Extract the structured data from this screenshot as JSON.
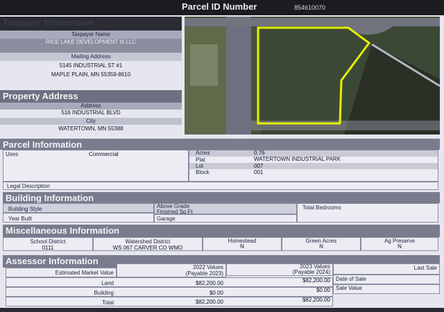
{
  "header": {
    "parcel_id_label": "Parcel ID Number",
    "parcel_id": "854610070"
  },
  "taxpayer": {
    "section_title": "Taxpayer Information",
    "name_label": "Taxpayer Name",
    "name": "RICE LAKE DEVELOPMENT III LLC",
    "mailing_label": "Mailing Address",
    "mailing_line1": "5145 INDUSTRIAL ST #1",
    "mailing_line2": "MAPLE PLAIN, MN 55359-8610"
  },
  "property": {
    "section_title": "Property Address",
    "address_label": "Address",
    "address": "516 INDUSTRIAL BLVD",
    "city_label": "City",
    "city": "WATERTOWN, MN 55388"
  },
  "parcel": {
    "section_title": "Parcel Information",
    "uses_label": "Uses",
    "uses": "Commercial",
    "acres_label": "Acres",
    "acres": "0.76",
    "plat_label": "Plat",
    "plat": "WATERTOWN INDUSTRIAL PARK",
    "lot_label": "Lot",
    "lot": "007",
    "block_label": "Block",
    "block": "001",
    "legal_label": "Legal Description"
  },
  "building": {
    "section_title": "Building Information",
    "style_label": "Building Style",
    "year_label": "Year Built",
    "above_grade_label_1": "Above Grade",
    "above_grade_label_2": "Finished Sq Ft",
    "garage_label": "Garage",
    "bedrooms_label": "Total Bedrooms"
  },
  "misc": {
    "section_title": "Miscellaneous Information",
    "school_label": "School District",
    "school": "0111",
    "watershed_label": "Watershed District",
    "watershed": "WS 067 CARVER CO WMO",
    "homestead_label": "Homestead",
    "homestead": "N",
    "green_label": "Green Acres",
    "green": "N",
    "ag_label": "Ag Preserve",
    "ag": "N"
  },
  "assessor": {
    "section_title": "Assessor Information",
    "emv_label": "Estimated Market Value",
    "col2022_1": "2022 Values",
    "col2022_2": "(Payable 2023)",
    "col2023_1": "2023 Values",
    "col2023_2": "(Payable 2024)",
    "last_sale_label": "Last Sale",
    "date_sale_label": "Date of Sale",
    "sale_value_label": "Sale Value",
    "rows": [
      {
        "label": "Land",
        "v2022": "$82,200.00",
        "v2023": "$82,200.00"
      },
      {
        "label": "Building",
        "v2022": "$0.00",
        "v2023": "$0.00"
      },
      {
        "label": "Total",
        "v2022": "$82,200.00",
        "v2023": "$82,200.00"
      }
    ]
  },
  "colors": {
    "section_header": "#6e6f80",
    "parcel_outline": "#e6f000"
  }
}
